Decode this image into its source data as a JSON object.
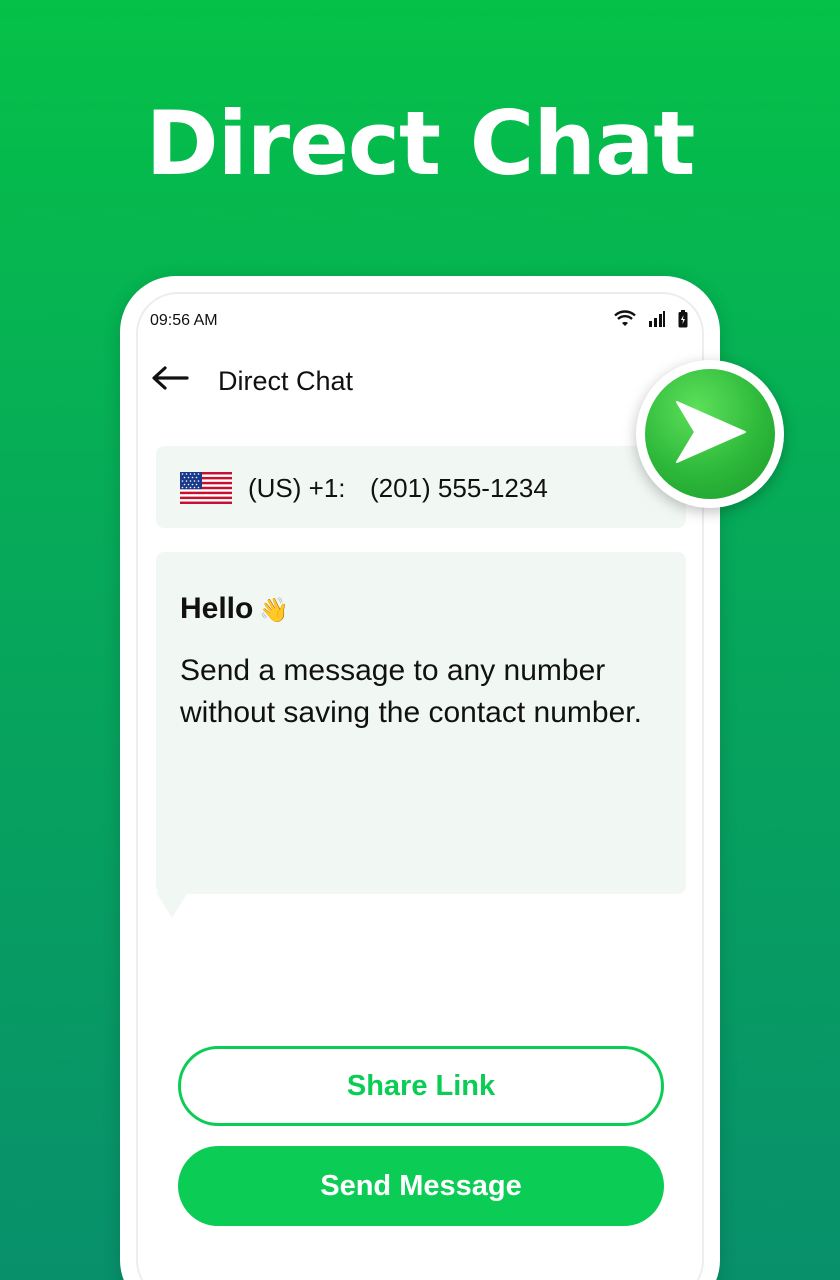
{
  "header": {
    "headline": "Direct Chat"
  },
  "status_bar": {
    "time": "09:56 AM",
    "icons": [
      "wifi-icon",
      "signal-icon",
      "battery-icon"
    ]
  },
  "app_bar": {
    "back_icon": "arrow-left-icon",
    "title": "Direct Chat"
  },
  "phone_input": {
    "flag_icon": "us-flag-icon",
    "country_code": "(US) +1:",
    "number": "(201) 555-1234"
  },
  "message": {
    "greeting": "Hello",
    "greeting_emoji": "👋",
    "body": "Send a message to any number without saving the contact number."
  },
  "buttons": {
    "share_label": "Share Link",
    "send_label": "Send Message"
  },
  "colors": {
    "accent": "#0bcd55",
    "card_bg": "#f1f8f4",
    "background_top": "#05c148",
    "background_bottom": "#08906b"
  }
}
